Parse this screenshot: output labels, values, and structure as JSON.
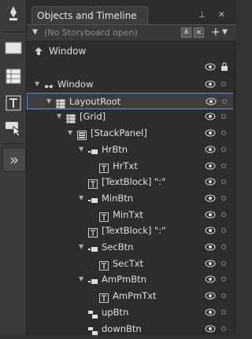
{
  "panel": {
    "tab_title": "Objects and Timeline",
    "header_icons": "⊥ ✕",
    "storyboard_placeholder": "(No Storyboard open)",
    "scope_label": "Window"
  },
  "tree": [
    {
      "label": "Window",
      "level": 0,
      "caret": "▼",
      "icon": "window-icon",
      "selected": false
    },
    {
      "label": "LayoutRoot",
      "level": 1,
      "caret": "▼",
      "icon": "grid-icon",
      "selected": true
    },
    {
      "label": "[Grid]",
      "level": 2,
      "caret": "▼",
      "icon": "grid-icon",
      "selected": false
    },
    {
      "label": "[StackPanel]",
      "level": 3,
      "caret": "▼",
      "icon": "stackpanel-icon",
      "selected": false
    },
    {
      "label": "HrBtn",
      "level": 4,
      "caret": "▼",
      "icon": "button-icon",
      "selected": false
    },
    {
      "label": "HrTxt",
      "level": 5,
      "caret": "",
      "icon": "textblock-icon",
      "selected": false
    },
    {
      "label": "[TextBlock] \":\"",
      "level": 4,
      "caret": "",
      "icon": "textblock-icon",
      "selected": false
    },
    {
      "label": "MinBtn",
      "level": 4,
      "caret": "▼",
      "icon": "button-icon",
      "selected": false
    },
    {
      "label": "MinTxt",
      "level": 5,
      "caret": "",
      "icon": "textblock-icon",
      "selected": false
    },
    {
      "label": "[TextBlock] \":\"",
      "level": 4,
      "caret": "",
      "icon": "textblock-icon",
      "selected": false
    },
    {
      "label": "SecBtn",
      "level": 4,
      "caret": "▼",
      "icon": "button-icon",
      "selected": false
    },
    {
      "label": "SecTxt",
      "level": 5,
      "caret": "",
      "icon": "textblock-icon",
      "selected": false
    },
    {
      "label": "AmPmBtn",
      "level": 4,
      "caret": "▼",
      "icon": "button-icon",
      "selected": false
    },
    {
      "label": "AmPmTxt",
      "level": 5,
      "caret": "",
      "icon": "textblock-icon",
      "selected": false
    },
    {
      "label": "upBtn",
      "level": 4,
      "caret": "",
      "icon": "repeatbutton-icon",
      "selected": false
    },
    {
      "label": "downBtn",
      "level": 4,
      "caret": "",
      "icon": "repeatbutton-icon",
      "selected": false
    }
  ],
  "tools": [
    "pen-tool-icon",
    "rectangle-tool-icon",
    "grid-tool-icon",
    "text-tool-icon",
    "selection-tool-icon"
  ],
  "expand_glyph": "»",
  "colors": {
    "selection_border": "#6d8fb8",
    "panel_bg": "#2d2d2d"
  }
}
